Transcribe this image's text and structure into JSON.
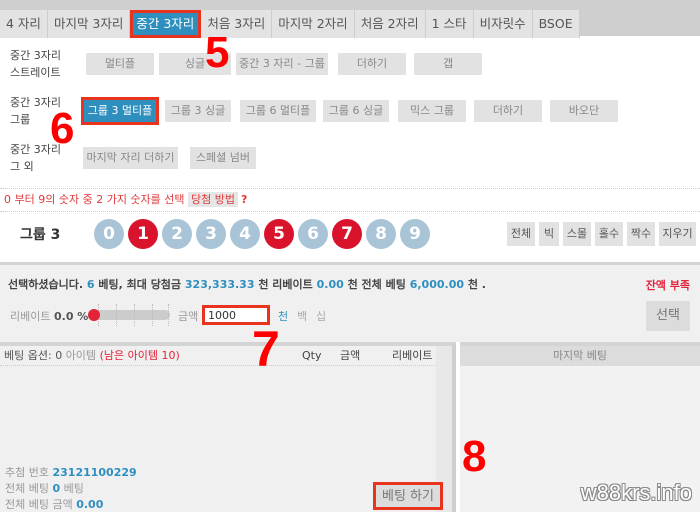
{
  "tabs": [
    {
      "label": "4 자리",
      "active": false
    },
    {
      "label": "마지막 3자리",
      "active": false
    },
    {
      "label": "중간 3자리",
      "active": true
    },
    {
      "label": "처음 3자리",
      "active": false
    },
    {
      "label": "마지막 2자리",
      "active": false
    },
    {
      "label": "처음 2자리",
      "active": false
    },
    {
      "label": "1 스타",
      "active": false
    },
    {
      "label": "비자릿수",
      "active": false
    },
    {
      "label": "BSOE",
      "active": false
    }
  ],
  "options": {
    "straight": {
      "label_line1": "중간 3자리",
      "label_line2": "스트레이트",
      "buttons": [
        "멀티플",
        "싱글",
        "중간 3 자리 - 그룹",
        "더하기",
        "갭"
      ]
    },
    "group": {
      "label_line1": "중간 3자리",
      "label_line2": "그룹",
      "buttons": [
        "그룹 3 멀티플",
        "그룹 3 싱글",
        "그룹 6 멀티플",
        "그룹 6 싱글",
        "믹스 그룹",
        "더하기",
        "바오단"
      ],
      "active_index": 0
    },
    "other": {
      "label_line1": "중간 3자리",
      "label_line2": "그 외",
      "buttons": [
        "마지막 자리 더하기",
        "스페셜 넘버"
      ]
    }
  },
  "hint": {
    "text": "0 부터 9의 숫자 중 2 가지 숫자를 선택",
    "link": "당첨 방법",
    "help": "?"
  },
  "number_picker": {
    "title": "그룹 3",
    "numbers": [
      "0",
      "1",
      "2",
      "3",
      "4",
      "5",
      "6",
      "7",
      "8",
      "9"
    ],
    "selected": [
      "1",
      "5",
      "7"
    ],
    "quick_buttons": [
      "전체",
      "빅",
      "스몰",
      "홀수",
      "짝수",
      "지우기"
    ],
    "colors": {
      "selected": "#d9132b",
      "unselected": "#a8c4d6"
    }
  },
  "summary": {
    "prefix": "선택하셨습니다.",
    "bets": "6",
    "bets_unit": "베팅, 최대 당첨금",
    "max_win": "323,333.33",
    "unit1": "천 리베이트",
    "rebate": "0.00",
    "unit2": "천 전체 베팅",
    "total": "6,000.00",
    "unit3": "천 .",
    "warning": "잔액 부족",
    "rebate_label": "리베이트",
    "rebate_value": "0.0 %",
    "rebate_slider_fraction": 0.0,
    "amount_label": "금액",
    "amount_value": "1000",
    "units": [
      "천",
      "백",
      "십"
    ],
    "active_unit": "천",
    "select_button": "선택"
  },
  "bet_options": {
    "label": "베팅 옵션:",
    "count": "0",
    "count_unit": "아이템",
    "remaining": "(남은 아이템 10)",
    "columns": [
      "Qty",
      "금액",
      "리베이트"
    ],
    "draw_label": "추첨 번호",
    "draw_number": "23121100229",
    "total_bets_label": "전체 베팅",
    "total_bets": "0",
    "total_bets_unit": "베팅",
    "total_amount_label": "전체 베팅 금액",
    "total_amount": "0.00",
    "bet_button": "베팅 하기"
  },
  "last_bets": {
    "title": "마지막 베팅"
  },
  "annotations": [
    "5",
    "6",
    "7",
    "8"
  ],
  "watermark": "w88krs.info",
  "accent": "#2e8fbf",
  "highlight": "#e8331e"
}
